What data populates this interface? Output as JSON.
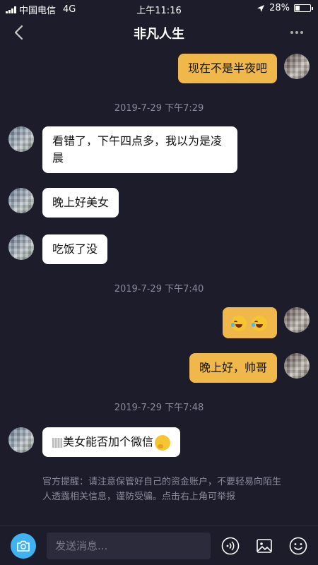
{
  "status_bar": {
    "carrier": "中国电信",
    "network": "4G",
    "time": "上午11:16",
    "battery": "28%",
    "battery_level": 0.28
  },
  "nav": {
    "title": "非凡人生"
  },
  "messages": [
    {
      "side": "out",
      "text": "现在不是半夜吧"
    },
    {
      "type": "time",
      "text": "2019-7-29 下午7:29"
    },
    {
      "side": "in",
      "text_line1": "看错了，下午四点多，我以为是凌",
      "text_line2": "晨"
    },
    {
      "side": "in",
      "text": "晚上好美女"
    },
    {
      "side": "in",
      "text": "吃饭了没"
    },
    {
      "type": "time",
      "text": "2019-7-29 下午7:40"
    },
    {
      "side": "out",
      "emojis": [
        "laughing-tears",
        "laughing-tears"
      ]
    },
    {
      "side": "out",
      "text": "晚上好，帅哥"
    },
    {
      "type": "time",
      "text": "2019-7-29 下午7:48"
    },
    {
      "side": "in",
      "text": "美女能否加个微信",
      "trailing_emoji": "thinking"
    }
  ],
  "notice": {
    "text": "官方提醒：请注意保管好自己的资金账户，不要轻易向陌生人透露相关信息，谨防受骗。点击右上角可举报"
  },
  "input_bar": {
    "placeholder": "发送消息..."
  },
  "colors": {
    "background": "#1c1c2a",
    "outgoing_bubble": "#f0b84a",
    "incoming_bubble": "#ffffff",
    "camera_button": "#3fb3f1"
  }
}
